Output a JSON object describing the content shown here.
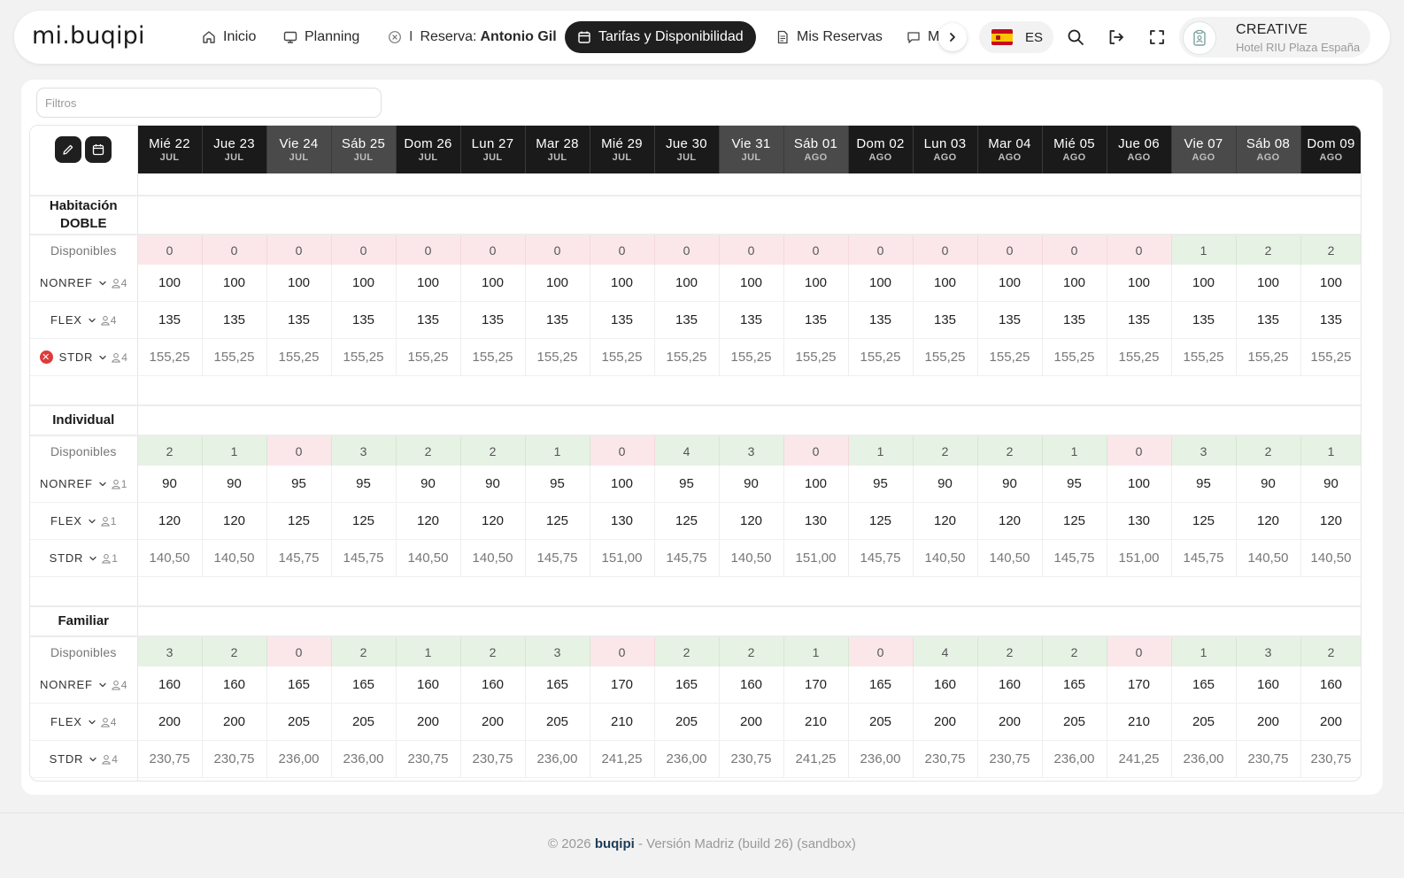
{
  "app": {
    "logo": "mi.buqipi"
  },
  "nav": {
    "items": [
      {
        "label": "Inicio",
        "icon": "home-icon"
      },
      {
        "label": "Planning",
        "icon": "monitor-icon"
      },
      {
        "label": "Reserva:",
        "strong": "Antonio Gil",
        "icon": "close-circle-icon"
      },
      {
        "label": "Tarifas y Disponibilidad",
        "icon": "calendar-icon",
        "active": true
      },
      {
        "label": "Mis Reservas",
        "icon": "document-icon"
      },
      {
        "label": "M",
        "icon": "chat-icon"
      }
    ],
    "separator": "I"
  },
  "language": {
    "code": "ES",
    "flag": "spain-flag"
  },
  "user": {
    "name": "CREATIVE",
    "hotel": "Hotel RIU Plaza España"
  },
  "filters": {
    "placeholder": "Filtros"
  },
  "dates": [
    {
      "day": "Mié 22",
      "month": "JUL",
      "weekend": false
    },
    {
      "day": "Jue 23",
      "month": "JUL",
      "weekend": false
    },
    {
      "day": "Vie 24",
      "month": "JUL",
      "weekend": true
    },
    {
      "day": "Sáb 25",
      "month": "JUL",
      "weekend": true
    },
    {
      "day": "Dom 26",
      "month": "JUL",
      "weekend": false
    },
    {
      "day": "Lun 27",
      "month": "JUL",
      "weekend": false
    },
    {
      "day": "Mar 28",
      "month": "JUL",
      "weekend": false
    },
    {
      "day": "Mié 29",
      "month": "JUL",
      "weekend": false
    },
    {
      "day": "Jue 30",
      "month": "JUL",
      "weekend": false
    },
    {
      "day": "Vie 31",
      "month": "JUL",
      "weekend": true
    },
    {
      "day": "Sáb 01",
      "month": "AGO",
      "weekend": true
    },
    {
      "day": "Dom 02",
      "month": "AGO",
      "weekend": false
    },
    {
      "day": "Lun 03",
      "month": "AGO",
      "weekend": false
    },
    {
      "day": "Mar 04",
      "month": "AGO",
      "weekend": false
    },
    {
      "day": "Mié 05",
      "month": "AGO",
      "weekend": false
    },
    {
      "day": "Jue 06",
      "month": "AGO",
      "weekend": false
    },
    {
      "day": "Vie 07",
      "month": "AGO",
      "weekend": true
    },
    {
      "day": "Sáb 08",
      "month": "AGO",
      "weekend": true
    },
    {
      "day": "Dom 09",
      "month": "AGO",
      "weekend": false
    }
  ],
  "availability_label": "Disponibles",
  "rooms": [
    {
      "title": "Habitación DOBLE",
      "available": [
        0,
        0,
        0,
        0,
        0,
        0,
        0,
        0,
        0,
        0,
        0,
        0,
        0,
        0,
        0,
        0,
        1,
        2,
        2
      ],
      "rates": [
        {
          "name": "NONREF",
          "pax": "4",
          "closed": false,
          "values": [
            "100",
            "100",
            "100",
            "100",
            "100",
            "100",
            "100",
            "100",
            "100",
            "100",
            "100",
            "100",
            "100",
            "100",
            "100",
            "100",
            "100",
            "100",
            "100"
          ]
        },
        {
          "name": "FLEX",
          "pax": "4",
          "closed": false,
          "values": [
            "135",
            "135",
            "135",
            "135",
            "135",
            "135",
            "135",
            "135",
            "135",
            "135",
            "135",
            "135",
            "135",
            "135",
            "135",
            "135",
            "135",
            "135",
            "135"
          ]
        },
        {
          "name": "STDR",
          "pax": "4",
          "closed": true,
          "values": [
            "155,25",
            "155,25",
            "155,25",
            "155,25",
            "155,25",
            "155,25",
            "155,25",
            "155,25",
            "155,25",
            "155,25",
            "155,25",
            "155,25",
            "155,25",
            "155,25",
            "155,25",
            "155,25",
            "155,25",
            "155,25",
            "155,25"
          ]
        }
      ]
    },
    {
      "title": "Individual",
      "available": [
        2,
        1,
        0,
        3,
        2,
        2,
        1,
        0,
        4,
        3,
        0,
        1,
        2,
        2,
        1,
        0,
        3,
        2,
        1
      ],
      "rates": [
        {
          "name": "NONREF",
          "pax": "1",
          "closed": false,
          "values": [
            "90",
            "90",
            "95",
            "95",
            "90",
            "90",
            "95",
            "100",
            "95",
            "90",
            "100",
            "95",
            "90",
            "90",
            "95",
            "100",
            "95",
            "90",
            "90"
          ]
        },
        {
          "name": "FLEX",
          "pax": "1",
          "closed": false,
          "values": [
            "120",
            "120",
            "125",
            "125",
            "120",
            "120",
            "125",
            "130",
            "125",
            "120",
            "130",
            "125",
            "120",
            "120",
            "125",
            "130",
            "125",
            "120",
            "120"
          ]
        },
        {
          "name": "STDR",
          "pax": "1",
          "closed": false,
          "values": [
            "140,50",
            "140,50",
            "145,75",
            "145,75",
            "140,50",
            "140,50",
            "145,75",
            "151,00",
            "145,75",
            "140,50",
            "151,00",
            "145,75",
            "140,50",
            "140,50",
            "145,75",
            "151,00",
            "145,75",
            "140,50",
            "140,50"
          ]
        }
      ]
    },
    {
      "title": "Familiar",
      "available": [
        3,
        2,
        0,
        2,
        1,
        2,
        3,
        0,
        2,
        2,
        1,
        0,
        4,
        2,
        2,
        0,
        1,
        3,
        2
      ],
      "rates": [
        {
          "name": "NONREF",
          "pax": "4",
          "closed": false,
          "values": [
            "160",
            "160",
            "165",
            "165",
            "160",
            "160",
            "165",
            "170",
            "165",
            "160",
            "170",
            "165",
            "160",
            "160",
            "165",
            "170",
            "165",
            "160",
            "160"
          ]
        },
        {
          "name": "FLEX",
          "pax": "4",
          "closed": false,
          "values": [
            "200",
            "200",
            "205",
            "205",
            "200",
            "200",
            "205",
            "210",
            "205",
            "200",
            "210",
            "205",
            "200",
            "200",
            "205",
            "210",
            "205",
            "200",
            "200"
          ]
        },
        {
          "name": "STDR",
          "pax": "4",
          "closed": false,
          "values": [
            "230,75",
            "230,75",
            "236,00",
            "236,00",
            "230,75",
            "230,75",
            "236,00",
            "241,25",
            "236,00",
            "230,75",
            "241,25",
            "236,00",
            "230,75",
            "230,75",
            "236,00",
            "241,25",
            "236,00",
            "230,75",
            "230,75"
          ]
        }
      ]
    }
  ],
  "footer": {
    "prefix": "© 2026",
    "brand": "buqipi",
    "suffix": "- Versión Madriz (build 26) (sandbox)"
  },
  "colors": {
    "available_zero_bg": "#fbe7ea",
    "available_positive_bg": "#e6f2e4",
    "header_dark": "#1a1a1a",
    "header_weekend": "#4a4a4a",
    "closed_rate_icon": "#e03a3a",
    "brand": "#1d3c57"
  }
}
